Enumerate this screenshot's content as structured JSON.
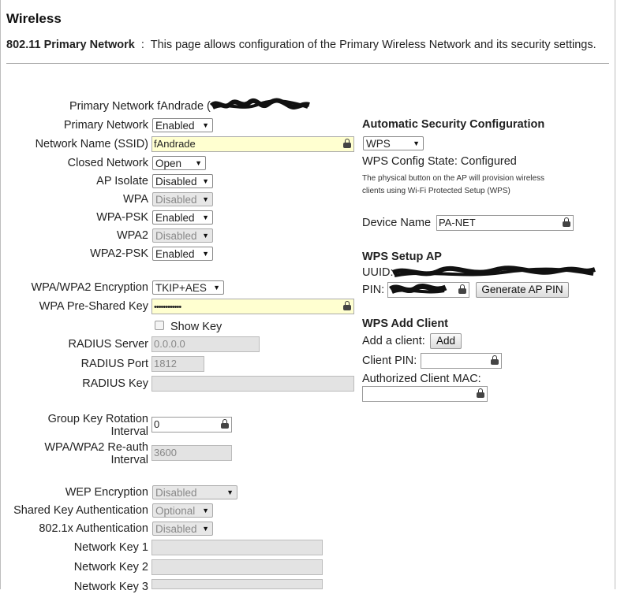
{
  "page": {
    "title": "Wireless",
    "subtitle_bold": "802.11 Primary Network",
    "subtitle_sep": ":",
    "subtitle_text": "This page allows configuration of the Primary Wireless Network and its security settings."
  },
  "left": {
    "primary_network_header": "Primary Network fAndrade (",
    "fields": {
      "primary_network": {
        "label": "Primary Network",
        "value": "Enabled"
      },
      "ssid": {
        "label": "Network Name (SSID)",
        "value": "fAndrade"
      },
      "closed_network": {
        "label": "Closed Network",
        "value": "Open"
      },
      "ap_isolate": {
        "label": "AP Isolate",
        "value": "Disabled"
      },
      "wpa": {
        "label": "WPA",
        "value": "Disabled"
      },
      "wpa_psk": {
        "label": "WPA-PSK",
        "value": "Enabled"
      },
      "wpa2": {
        "label": "WPA2",
        "value": "Disabled"
      },
      "wpa2_psk": {
        "label": "WPA2-PSK",
        "value": "Enabled"
      },
      "encryption": {
        "label": "WPA/WPA2 Encryption",
        "value": "TKIP+AES"
      },
      "psk": {
        "label": "WPA Pre-Shared Key",
        "value": "••••••••••••"
      },
      "show_key": {
        "label": "Show Key"
      },
      "radius_server": {
        "label": "RADIUS Server",
        "value": "0.0.0.0"
      },
      "radius_port": {
        "label": "RADIUS Port",
        "value": "1812"
      },
      "radius_key": {
        "label": "RADIUS Key",
        "value": ""
      },
      "group_key_line1": "Group Key Rotation",
      "group_key_line2": "Interval",
      "group_key_value": "0",
      "reauth_line1": "WPA/WPA2 Re-auth",
      "reauth_line2": "Interval",
      "reauth_value": "3600",
      "wep_encryption": {
        "label": "WEP Encryption",
        "value": "Disabled"
      },
      "shared_key_auth": {
        "label": "Shared Key Authentication",
        "value": "Optional"
      },
      "auth_8021x": {
        "label": "802.1x Authentication",
        "value": "Disabled"
      },
      "network_key_1": {
        "label": "Network Key 1",
        "value": ""
      },
      "network_key_2": {
        "label": "Network Key 2",
        "value": ""
      },
      "network_key_3": {
        "label": "Network Key 3",
        "value": ""
      }
    }
  },
  "right": {
    "auto_sec_title": "Automatic Security Configuration",
    "auto_sec_value": "WPS",
    "wps_state": "WPS Config State: Configured",
    "wps_note_line1": "The physical button on the AP will provision wireless",
    "wps_note_line2": "clients using Wi-Fi Protected Setup (WPS)",
    "device_name_label": "Device Name",
    "device_name_value": "PA-NET",
    "wps_setup_title": "WPS Setup AP",
    "uuid_label": "UUID:",
    "pin_label": "PIN:",
    "generate_pin_button": "Generate AP PIN",
    "wps_add_title": "WPS Add Client",
    "add_client_label": "Add a client:",
    "add_button": "Add",
    "client_pin_label": "Client PIN:",
    "client_pin_value": "",
    "auth_mac_label": "Authorized Client MAC:",
    "auth_mac_value": ""
  }
}
